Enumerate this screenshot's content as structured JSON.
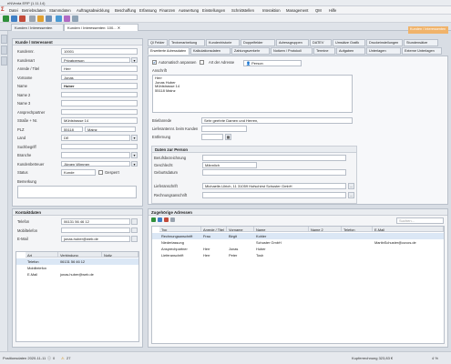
{
  "window": {
    "title": "eNVenta ERP (1.11.14)"
  },
  "menu": [
    "Datei",
    "Betriebsdaten",
    "Stammdaten",
    "Auftragsabwicklung",
    "Beschaffung",
    "Erfassung",
    "Finanzen",
    "Auswertung",
    "Einstellungen",
    "Schnittstellen",
    "Interaktion",
    "Management",
    "QM",
    "Hilfe"
  ],
  "doc_tabs": [
    "Kunden / Interessenten",
    "Kunden / Interessenten: 100..."
  ],
  "badge": "Kunden / Interessenten",
  "kunde": {
    "header": "Kunde / Interessent",
    "fields": [
      {
        "label": "Kundennr.",
        "value": "10001"
      },
      {
        "label": "Kundenart",
        "value": "Privatperson"
      },
      {
        "label": "Anrede / Titel",
        "value": "Herr"
      },
      {
        "label": "Vorname",
        "value": "Jonas"
      },
      {
        "label": "Name",
        "value": "Huber"
      },
      {
        "label": "Name 2",
        "value": ""
      },
      {
        "label": "Name 3",
        "value": ""
      },
      {
        "label": "Ansprechpartner",
        "value": ""
      },
      {
        "label": "Straße + Nr.",
        "value": "Mühlstrasse 14"
      },
      {
        "label": "PLZ",
        "value": "55118",
        "value2": "Mainz"
      },
      {
        "label": "Land",
        "value": "DE"
      },
      {
        "label": "Suchbegriff",
        "value": ""
      },
      {
        "label": "Branche",
        "value": ""
      },
      {
        "label": "Kundenbetreuer",
        "value": "Jürgen Wimmer"
      },
      {
        "label": "Status",
        "value": "Kunde",
        "check": "Gesperrt"
      },
      {
        "label": "Bemerkung",
        "value": ""
      }
    ]
  },
  "kontakt": {
    "header": "Kontaktdaten",
    "fields": [
      {
        "label": "Telefon",
        "value": "06131 56 46 12"
      },
      {
        "label": "Mobiltelefon",
        "value": ""
      },
      {
        "label": "E-Mail",
        "value": "jonas.huber@web.de"
      }
    ],
    "grid_cols": [
      "Art",
      "Verbindung",
      "Notiz"
    ],
    "grid_rows": [
      {
        "art": "Telefon",
        "verb": "06131 56 46 12",
        "notiz": ""
      },
      {
        "art": "Mobiltelefon",
        "verb": "",
        "notiz": ""
      },
      {
        "art": "E-Mail",
        "verb": "jonas.huber@web.de",
        "notiz": ""
      }
    ]
  },
  "right_tabs_row1": [
    "Ql Felder",
    "Textverarbeitung",
    "Kundenhistorie",
    "Doppelfelder",
    "Adressgruppen",
    "DATEV",
    "Umsätze Grafik",
    "Druckeinstellungen",
    "Stundensätze"
  ],
  "right_tabs_row2": [
    "Erweiterte Adressdaten",
    "Kalkulationsdaten",
    "Zahlungsverkehr",
    "Notizen / Protokoll",
    "Termine",
    "Aufgaben",
    "Unterlagen",
    "Externe Unterlagen"
  ],
  "adress": {
    "auto_label": "Automatisch anpassen",
    "art_label": "Art der Adresse",
    "art_value": "Person",
    "anschrift_label": "Anschrift",
    "anschrift": "Herr\nJonas Huber\nMühlstrasse 14\n55118 Mainz",
    "briefanrede_label": "Briefanrede",
    "briefanrede": "Sehr geehrte Damen und Herren,",
    "lieferantennr_label": "Lieferantennr. beim Kunden",
    "lieferantennr": "",
    "entfernung_label": "Entfernung",
    "entfernung": ""
  },
  "person": {
    "header": "Daten zur Person",
    "fields": [
      {
        "label": "Berufsbezeichnung",
        "value": ""
      },
      {
        "label": "Geschlecht",
        "value": "Männlich"
      },
      {
        "label": "Geburtsdatum",
        "value": ""
      }
    ],
    "lieferanschrift_label": "Lieferanschrift",
    "lieferanschrift": "Michaelle-Ulrich, 11 31059 Hofschirst Schuster GmbH",
    "rechnung_label": "Rechnungsanschrift",
    "rechnung": ""
  },
  "zugeh": {
    "header": "Zugehörige Adressen",
    "search_placeholder": "Suchen...",
    "cols": [
      "Typ",
      "Anrede / Titel",
      "Vorname",
      "Name",
      "Name 2",
      "Telefon",
      "E-Mail"
    ],
    "rows": [
      [
        "Rechnungsanschrift",
        "Frau",
        "Birgit",
        "Kohler",
        "",
        "",
        ""
      ],
      [
        "Niederlassung",
        "",
        "",
        "Schuster GmbH",
        "",
        "",
        "MartinSchuster@cuvos.de"
      ],
      [
        "Ansprechpartner",
        "Herr",
        "Jonas",
        "Huber",
        "",
        "",
        ""
      ],
      [
        "Lieferanschrift",
        "Herr",
        "Peter",
        "Tosh",
        "",
        "",
        ""
      ]
    ]
  },
  "status": {
    "left": "Positionsdaten 2020-11-11",
    "count1": "0",
    "count2": "27",
    "right": "Kupferrechnung 323,83 €",
    "zoom": "4 %"
  }
}
